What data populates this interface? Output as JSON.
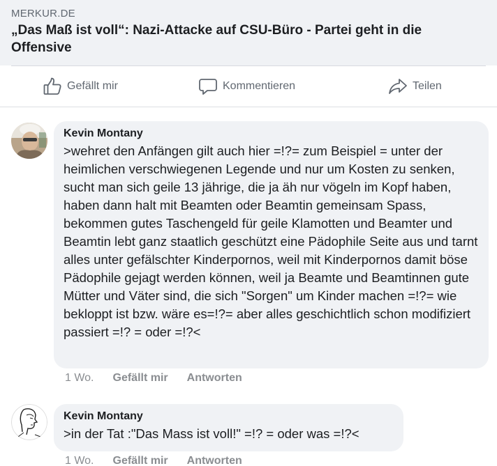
{
  "link_preview": {
    "domain": "MERKUR.DE",
    "title": "„Das Maß ist voll“: Nazi-Attacke auf CSU-Büro - Partei geht in die Offensive"
  },
  "actions": {
    "like": "Gefällt mir",
    "comment": "Kommentieren",
    "share": "Teilen"
  },
  "comments": [
    {
      "author": "Kevin Montany",
      "text": ">wehret den Anfängen gilt auch hier =!?= zum Beispiel = unter der heimlichen verschwiegenen Legende und nur um Kosten zu senken, sucht man sich geile 13 jährige, die ja äh nur vögeln im Kopf haben, haben dann halt mit Beamten oder Beamtin gemeinsam Spass, bekommen gutes Taschengeld für geile Klamotten und Beamter und Beamtin lebt ganz staatlich geschützt eine Pädophile Seite aus und tarnt alles unter gefälschter Kinderpornos, weil mit Kinderpornos damit böse Pädophile gejagt werden können, weil ja Beamte und Beamtinnen gute Mütter und Väter sind, die sich \"Sorgen\" um Kinder machen =!?= wie bekloppt ist bzw. wäre es=!?= aber alles geschichtlich schon modifiziert passiert =!? = oder =!?<",
      "time": "1 Wo.",
      "like": "Gefällt mir",
      "reply": "Antworten"
    },
    {
      "author": "Kevin Montany",
      "text": ">in der Tat :\"Das Mass ist voll!\" =!? = oder was =!?<",
      "time": "1 Wo.",
      "like": "Gefällt mir",
      "reply": "Antworten"
    }
  ],
  "colors": {
    "bubble": "#f0f2f5",
    "secondary_text": "#606770",
    "meta_text": "#8a8d91"
  }
}
